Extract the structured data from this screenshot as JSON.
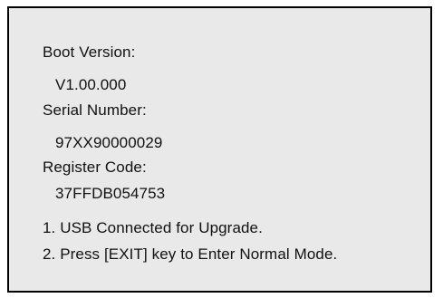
{
  "boot_version": {
    "label": "Boot Version:",
    "value": "V1.00.000"
  },
  "serial_number": {
    "label": "Serial Number:",
    "value": "97XX90000029"
  },
  "register_code": {
    "label": "Register Code:",
    "value": "37FFDB054753"
  },
  "messages": [
    "1. USB Connected for Upgrade.",
    "2. Press [EXIT] key to Enter Normal Mode."
  ],
  "colors": {
    "screen_background": "#e9e9e9",
    "border": "#000000",
    "text": "#111111"
  }
}
